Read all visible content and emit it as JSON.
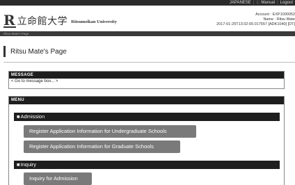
{
  "topbar": {
    "language": "JAPANESE",
    "separator": "|",
    "manual": "Manual",
    "logout": "Logout"
  },
  "header": {
    "logo_mark": "R",
    "logo_kanji": "立命館大学",
    "logo_english": "Ritsumeikan University",
    "account_line": "Account : EXP1000052",
    "name_line": "Name : Ritsu Mate",
    "session_line": "2017-01-25T13:32:00.017557 [ADK1040] [DT]"
  },
  "navbar": {
    "breadcrumb": "Ritsu Mate's Page"
  },
  "page": {
    "title": "Ritsu Mate's Page"
  },
  "message": {
    "heading": "MESSAGE",
    "link": "< Go to message box... >"
  },
  "menu": {
    "heading": "MENU",
    "sections": [
      {
        "marker": "■",
        "title": "Admission",
        "buttons": [
          "Register Application Information for Undergraduate Schools",
          "Register Application Information for Graduate Schools"
        ]
      },
      {
        "marker": "■",
        "title": "Inquiry",
        "buttons": [
          "Inquiry for Admission"
        ]
      }
    ]
  }
}
